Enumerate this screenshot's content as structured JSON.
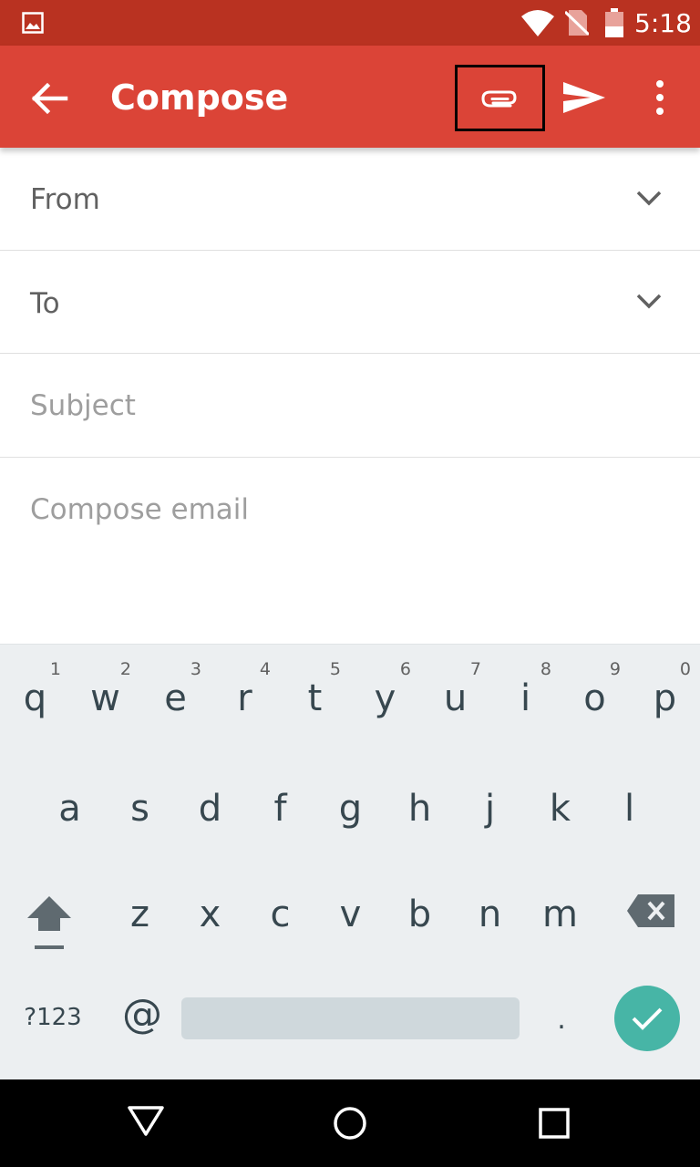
{
  "status_bar": {
    "time": "5:18",
    "icons": [
      "image-notification-icon",
      "wifi-icon",
      "no-sim-icon",
      "battery-icon"
    ]
  },
  "app_bar": {
    "title": "Compose",
    "actions": [
      "back-arrow-icon",
      "attach-icon",
      "send-icon",
      "more-vert-icon"
    ],
    "color": "#db4437"
  },
  "form": {
    "from_label": "From",
    "to_label": "To",
    "subject_placeholder": "Subject",
    "body_placeholder": "Compose email"
  },
  "keyboard": {
    "row1": [
      {
        "key": "q",
        "hint": "1"
      },
      {
        "key": "w",
        "hint": "2"
      },
      {
        "key": "e",
        "hint": "3"
      },
      {
        "key": "r",
        "hint": "4"
      },
      {
        "key": "t",
        "hint": "5"
      },
      {
        "key": "y",
        "hint": "6"
      },
      {
        "key": "u",
        "hint": "7"
      },
      {
        "key": "i",
        "hint": "8"
      },
      {
        "key": "o",
        "hint": "9"
      },
      {
        "key": "p",
        "hint": "0"
      }
    ],
    "row2": [
      "a",
      "s",
      "d",
      "f",
      "g",
      "h",
      "j",
      "k",
      "l"
    ],
    "row3": [
      "z",
      "x",
      "c",
      "v",
      "b",
      "n",
      "m"
    ],
    "symbols_label": "?123",
    "at_label": "@",
    "period_label": ".",
    "enter_color": "#47b5a6"
  },
  "nav_bar": {
    "buttons": [
      "back-triangle-icon",
      "home-circle-icon",
      "recents-square-icon"
    ]
  }
}
